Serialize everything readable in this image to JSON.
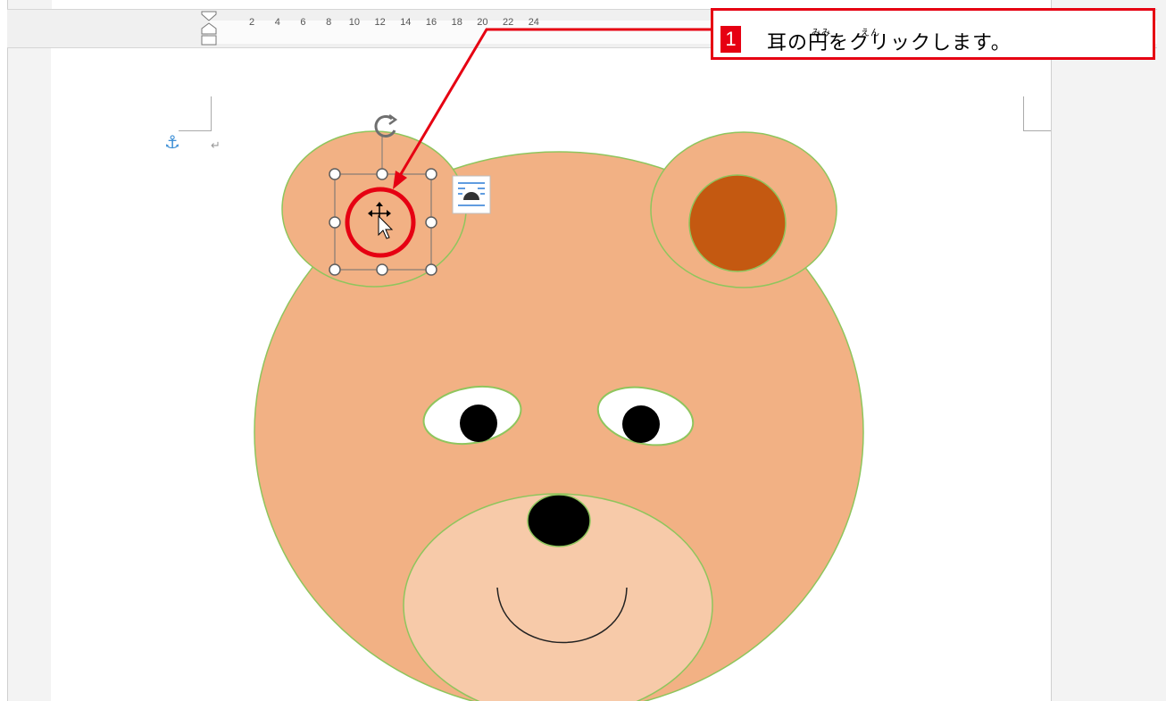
{
  "ruler": {
    "ticks": [
      "2",
      "4",
      "6",
      "8",
      "10",
      "12",
      "14",
      "16",
      "18",
      "20",
      "22",
      "24"
    ]
  },
  "document": {
    "anchor_icon": "anchor-icon",
    "paragraph_mark": "↵",
    "layout_options_icon": "layout-options-icon"
  },
  "instruction": {
    "step_number": "1",
    "text": "耳の円をクリックします。",
    "ruby_mimi": "みみ",
    "ruby_en": "えん"
  },
  "colors": {
    "face": "#f2b184",
    "muzzle": "#f7caa9",
    "inner_ear": "#c45911",
    "shape_outline": "#8fc55d",
    "highlight": "#e60012",
    "anchor": "#3d8fd6"
  }
}
